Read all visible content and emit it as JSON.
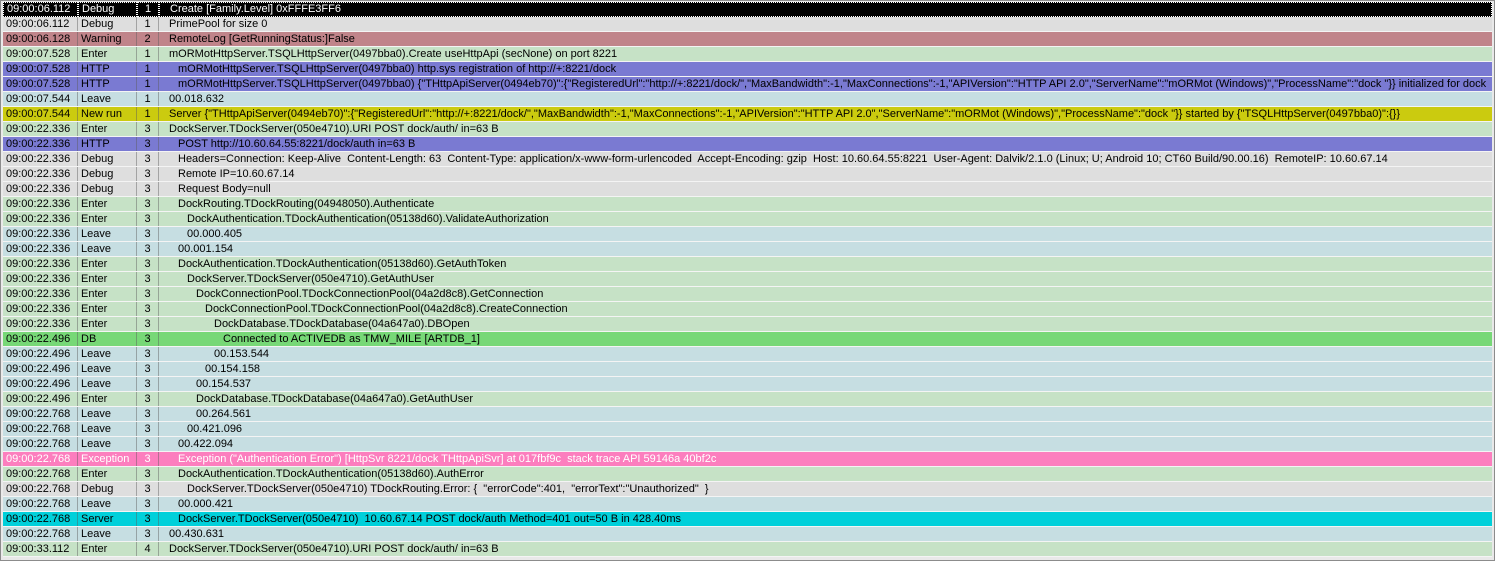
{
  "app": {
    "name": "log-viewer-grid",
    "columns": [
      "time",
      "level",
      "thread",
      "message"
    ]
  },
  "colors": {
    "text": "#000000",
    "debug": "#DEDEDE",
    "enter": "#C6E2C6",
    "leave": "#C6DEE2",
    "warning": "#C0848A",
    "http": "#7A7AD2",
    "newrun": "#CBCB0F",
    "db": "#77D877",
    "exception": "#FC7EBE",
    "exception_fg": "#FFFFFF",
    "server": "#00D0DA",
    "selected_bg": "#000000",
    "selected_fg": "#FFFFFF"
  },
  "rows": [
    {
      "time": "09:00:06.112",
      "level": "Debug",
      "thread": "1",
      "indent": 0,
      "type": "debug",
      "selected": true,
      "msg": "Create [Family.Level] 0xFFFE3FF6"
    },
    {
      "time": "09:00:06.112",
      "level": "Debug",
      "thread": "1",
      "indent": 0,
      "type": "debug",
      "msg": "PrimePool for size 0"
    },
    {
      "time": "09:00:06.128",
      "level": "Warning",
      "thread": "2",
      "indent": 0,
      "type": "warning",
      "msg": "RemoteLog [GetRunningStatus:]False"
    },
    {
      "time": "09:00:07.528",
      "level": "Enter",
      "thread": "1",
      "indent": 0,
      "type": "enter",
      "msg": "mORMotHttpServer.TSQLHttpServer(0497bba0).Create useHttpApi (secNone) on port 8221"
    },
    {
      "time": "09:00:07.528",
      "level": "HTTP",
      "thread": "1",
      "indent": 1,
      "type": "http",
      "msg": "mORMotHttpServer.TSQLHttpServer(0497bba0) http.sys registration of http://+:8221/dock"
    },
    {
      "time": "09:00:07.528",
      "level": "HTTP",
      "thread": "1",
      "indent": 1,
      "type": "http",
      "msg": "mORMotHttpServer.TSQLHttpServer(0497bba0) {\"THttpApiServer(0494eb70)\":{\"RegisteredUrl\":\"http://+:8221/dock/\",\"MaxBandwidth\":-1,\"MaxConnections\":-1,\"APIVersion\":\"HTTP API 2.0\",\"ServerName\":\"mORMot (Windows)\",\"ProcessName\":\"dock \"}} initialized for dock"
    },
    {
      "time": "09:00:07.544",
      "level": "Leave",
      "thread": "1",
      "indent": 0,
      "type": "leave",
      "msg": "00.018.632"
    },
    {
      "time": "09:00:07.544",
      "level": "New run",
      "thread": "1",
      "indent": 0,
      "type": "newrun",
      "msg": "Server {\"THttpApiServer(0494eb70)\":{\"RegisteredUrl\":\"http://+:8221/dock/\",\"MaxBandwidth\":-1,\"MaxConnections\":-1,\"APIVersion\":\"HTTP API 2.0\",\"ServerName\":\"mORMot (Windows)\",\"ProcessName\":\"dock \"}} started by {\"TSQLHttpServer(0497bba0)\":{}}"
    },
    {
      "time": "09:00:22.336",
      "level": "Enter",
      "thread": "3",
      "indent": 0,
      "type": "enter",
      "msg": "DockServer.TDockServer(050e4710).URI POST dock/auth/ in=63 B"
    },
    {
      "time": "09:00:22.336",
      "level": "HTTP",
      "thread": "3",
      "indent": 1,
      "type": "http",
      "msg": "POST http://10.60.64.55:8221/dock/auth in=63 B"
    },
    {
      "time": "09:00:22.336",
      "level": "Debug",
      "thread": "3",
      "indent": 1,
      "type": "debug",
      "msg": "Headers=Connection: Keep-Alive  Content-Length: 63  Content-Type: application/x-www-form-urlencoded  Accept-Encoding: gzip  Host: 10.60.64.55:8221  User-Agent: Dalvik/2.1.0 (Linux; U; Android 10; CT60 Build/90.00.16)  RemoteIP: 10.60.67.14"
    },
    {
      "time": "09:00:22.336",
      "level": "Debug",
      "thread": "3",
      "indent": 1,
      "type": "debug",
      "msg": "Remote IP=10.60.67.14"
    },
    {
      "time": "09:00:22.336",
      "level": "Debug",
      "thread": "3",
      "indent": 1,
      "type": "debug",
      "msg": "Request Body=null"
    },
    {
      "time": "09:00:22.336",
      "level": "Enter",
      "thread": "3",
      "indent": 1,
      "type": "enter",
      "msg": "DockRouting.TDockRouting(04948050).Authenticate"
    },
    {
      "time": "09:00:22.336",
      "level": "Enter",
      "thread": "3",
      "indent": 2,
      "type": "enter",
      "msg": "DockAuthentication.TDockAuthentication(05138d60).ValidateAuthorization"
    },
    {
      "time": "09:00:22.336",
      "level": "Leave",
      "thread": "3",
      "indent": 2,
      "type": "leave",
      "msg": "00.000.405"
    },
    {
      "time": "09:00:22.336",
      "level": "Leave",
      "thread": "3",
      "indent": 1,
      "type": "leave",
      "msg": "00.001.154"
    },
    {
      "time": "09:00:22.336",
      "level": "Enter",
      "thread": "3",
      "indent": 1,
      "type": "enter",
      "msg": "DockAuthentication.TDockAuthentication(05138d60).GetAuthToken"
    },
    {
      "time": "09:00:22.336",
      "level": "Enter",
      "thread": "3",
      "indent": 2,
      "type": "enter",
      "msg": "DockServer.TDockServer(050e4710).GetAuthUser"
    },
    {
      "time": "09:00:22.336",
      "level": "Enter",
      "thread": "3",
      "indent": 3,
      "type": "enter",
      "msg": "DockConnectionPool.TDockConnectionPool(04a2d8c8).GetConnection"
    },
    {
      "time": "09:00:22.336",
      "level": "Enter",
      "thread": "3",
      "indent": 4,
      "type": "enter",
      "msg": "DockConnectionPool.TDockConnectionPool(04a2d8c8).CreateConnection"
    },
    {
      "time": "09:00:22.336",
      "level": "Enter",
      "thread": "3",
      "indent": 5,
      "type": "enter",
      "msg": "DockDatabase.TDockDatabase(04a647a0).DBOpen"
    },
    {
      "time": "09:00:22.496",
      "level": "DB",
      "thread": "3",
      "indent": 6,
      "type": "db",
      "msg": "Connected to ACTIVEDB as TMW_MILE [ARTDB_1]"
    },
    {
      "time": "09:00:22.496",
      "level": "Leave",
      "thread": "3",
      "indent": 5,
      "type": "leave",
      "msg": "00.153.544"
    },
    {
      "time": "09:00:22.496",
      "level": "Leave",
      "thread": "3",
      "indent": 4,
      "type": "leave",
      "msg": "00.154.158"
    },
    {
      "time": "09:00:22.496",
      "level": "Leave",
      "thread": "3",
      "indent": 3,
      "type": "leave",
      "msg": "00.154.537"
    },
    {
      "time": "09:00:22.496",
      "level": "Enter",
      "thread": "3",
      "indent": 3,
      "type": "enter",
      "msg": "DockDatabase.TDockDatabase(04a647a0).GetAuthUser"
    },
    {
      "time": "09:00:22.768",
      "level": "Leave",
      "thread": "3",
      "indent": 3,
      "type": "leave",
      "msg": "00.264.561"
    },
    {
      "time": "09:00:22.768",
      "level": "Leave",
      "thread": "3",
      "indent": 2,
      "type": "leave",
      "msg": "00.421.096"
    },
    {
      "time": "09:00:22.768",
      "level": "Leave",
      "thread": "3",
      "indent": 1,
      "type": "leave",
      "msg": "00.422.094"
    },
    {
      "time": "09:00:22.768",
      "level": "Exception",
      "thread": "3",
      "indent": 1,
      "type": "exception",
      "msg": "Exception (\"Authentication Error\") [HttpSvr 8221/dock THttpApiSvr] at 017fbf9c  stack trace API 59146a 40bf2c"
    },
    {
      "time": "09:00:22.768",
      "level": "Enter",
      "thread": "3",
      "indent": 1,
      "type": "enter",
      "msg": "DockAuthentication.TDockAuthentication(05138d60).AuthError"
    },
    {
      "time": "09:00:22.768",
      "level": "Debug",
      "thread": "3",
      "indent": 2,
      "type": "debug",
      "msg": "DockServer.TDockServer(050e4710) TDockRouting.Error: {  \"errorCode\":401,  \"errorText\":\"Unauthorized\"  }"
    },
    {
      "time": "09:00:22.768",
      "level": "Leave",
      "thread": "3",
      "indent": 1,
      "type": "leave",
      "msg": "00.000.421"
    },
    {
      "time": "09:00:22.768",
      "level": "Server",
      "thread": "3",
      "indent": 1,
      "type": "server",
      "msg": "DockServer.TDockServer(050e4710)  10.60.67.14 POST dock/auth Method=401 out=50 B in 428.40ms"
    },
    {
      "time": "09:00:22.768",
      "level": "Leave",
      "thread": "3",
      "indent": 0,
      "type": "leave",
      "msg": "00.430.631"
    },
    {
      "time": "09:00:33.112",
      "level": "Enter",
      "thread": "4",
      "indent": 0,
      "type": "enter",
      "msg": "DockServer.TDockServer(050e4710).URI POST dock/auth/ in=63 B"
    }
  ]
}
